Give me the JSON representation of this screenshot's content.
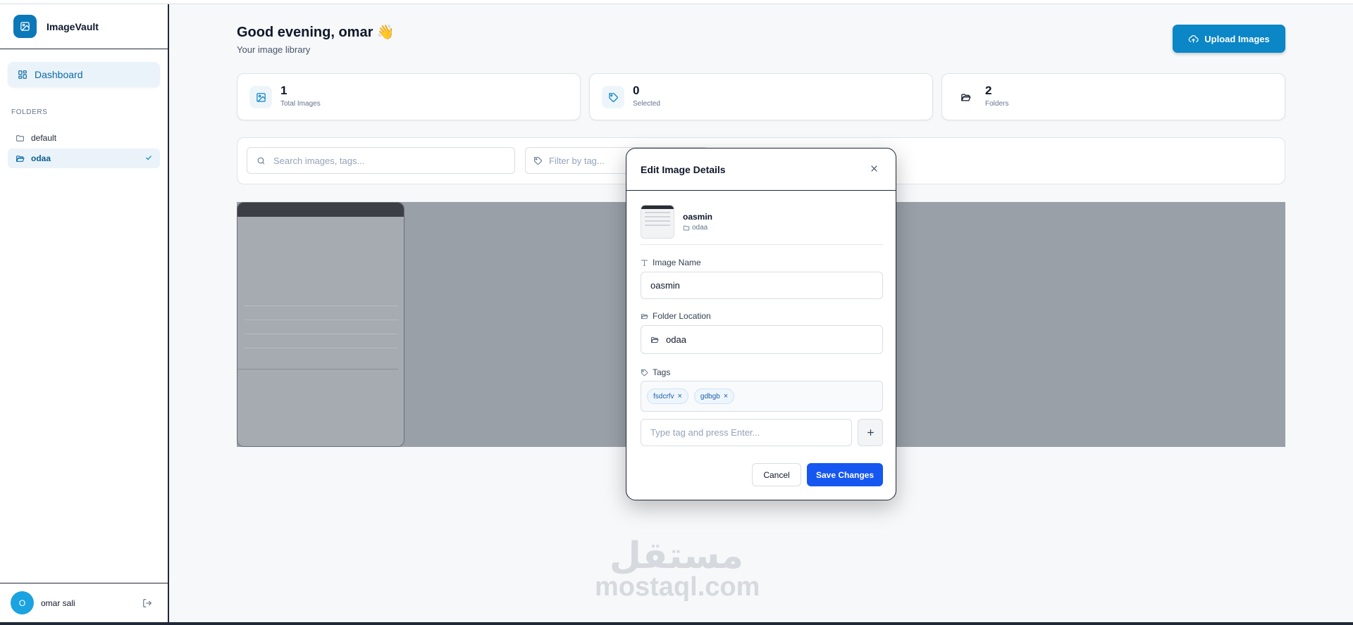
{
  "app": {
    "name": "ImageVault"
  },
  "sidebar": {
    "dashboard_label": "Dashboard",
    "folders_heading": "FOLDERS",
    "folders": [
      {
        "label": "default",
        "active": false
      },
      {
        "label": "odaa",
        "active": true
      }
    ],
    "user": {
      "initial": "O",
      "name": "omar sali"
    }
  },
  "header": {
    "greeting": "Good evening, omar 👋",
    "subtitle": "Your image library",
    "upload_label": "Upload Images"
  },
  "stats": [
    {
      "value": "1",
      "label": "Total Images",
      "icon": "image-icon"
    },
    {
      "value": "0",
      "label": "Selected",
      "icon": "tag-icon"
    },
    {
      "value": "2",
      "label": "Folders",
      "icon": "folder-open-icon"
    }
  ],
  "filters": {
    "search_placeholder": "Search images, tags...",
    "tag_placeholder": "Filter by tag..."
  },
  "modal": {
    "title": "Edit Image Details",
    "preview_name": "oasmin",
    "preview_folder": "odaa",
    "image_name_label": "Image Name",
    "image_name_value": "oasmin",
    "folder_label": "Folder Location",
    "folder_value": "odaa",
    "tags_label": "Tags",
    "tags": [
      "fsdcrfv",
      "gdbgb"
    ],
    "tag_input_placeholder": "Type tag and press Enter...",
    "cancel_label": "Cancel",
    "save_label": "Save Changes"
  },
  "watermark": {
    "arabic": "مستقل",
    "latin": "mostaql.com"
  },
  "colors": {
    "primary": "#0b86c6",
    "save": "#1557f0",
    "overlay": "#9aa0a8"
  }
}
